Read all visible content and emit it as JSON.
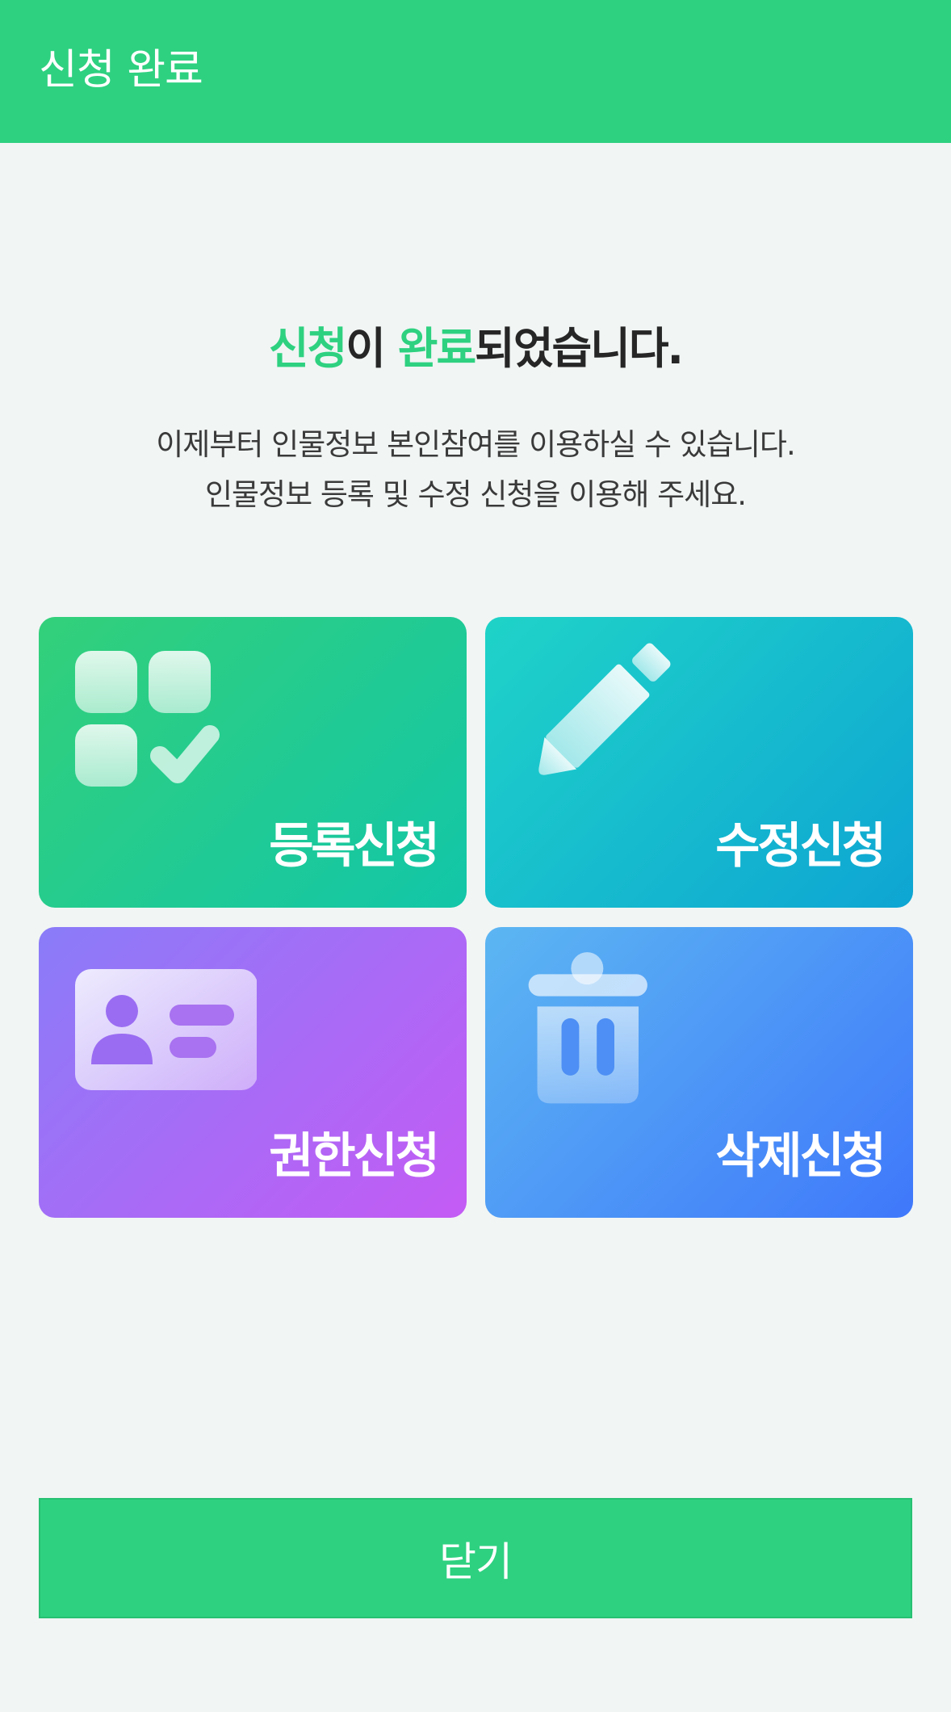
{
  "header": {
    "title": "신청 완료"
  },
  "headline": {
    "part1": "신청",
    "part2": "이 ",
    "part3": "완료",
    "part4": "되었습니다."
  },
  "description": {
    "line1": "이제부터 인물정보 본인참여를 이용하실 수 있습니다.",
    "line2": "인물정보 등록 및 수정 신청을 이용해 주세요."
  },
  "tiles": [
    {
      "label": "등록신청",
      "icon": "apps-check-icon"
    },
    {
      "label": "수정신청",
      "icon": "pencil-icon"
    },
    {
      "label": "권한신청",
      "icon": "id-card-icon"
    },
    {
      "label": "삭제신청",
      "icon": "trash-icon"
    }
  ],
  "footer": {
    "close_label": "닫기"
  },
  "colors": {
    "brand": "#2ed180",
    "register_tile": "#21cb91",
    "edit_tile": "#16bccd",
    "permission_tile": "#a76cf6",
    "delete_tile": "#4d97f6"
  }
}
